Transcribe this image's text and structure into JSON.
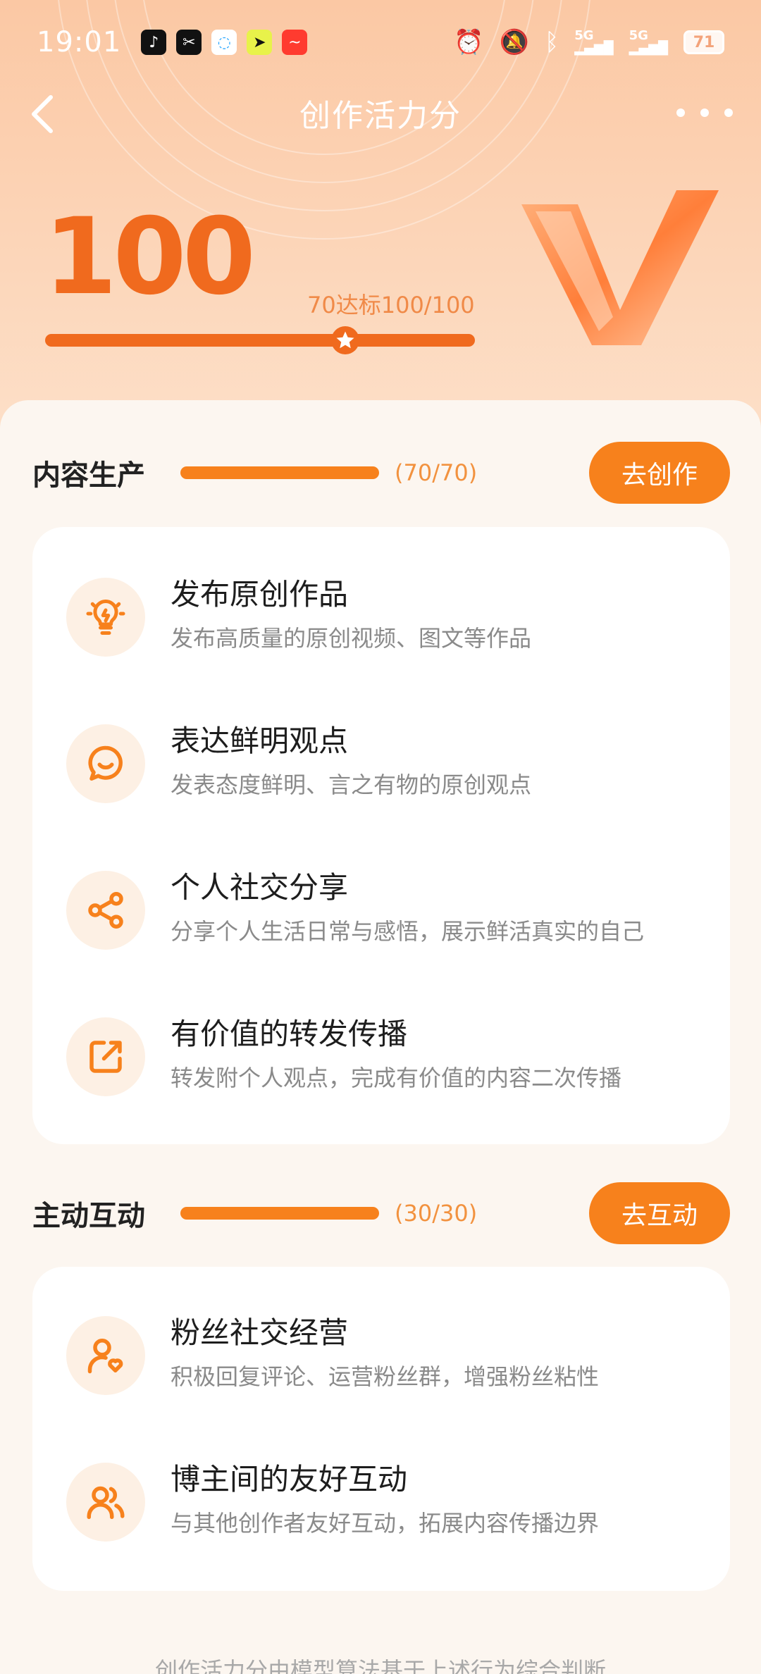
{
  "status_bar": {
    "time": "19:01",
    "battery": "71",
    "notification_icons": [
      "tiktok-icon",
      "capcut-icon",
      "chat-bubble-icon",
      "app-icon",
      "stock-app-icon"
    ],
    "system_icons": [
      "alarm-icon",
      "mute-icon",
      "bluetooth-icon",
      "signal-5g-icon",
      "signal-5g-icon"
    ],
    "signal_label": "5G"
  },
  "nav": {
    "title": "创作活力分",
    "back_icon": "chevron-left-icon",
    "more_icon": "more-dots-icon"
  },
  "summary": {
    "score": "100",
    "target_text": "70达标100/100",
    "progress": 1.0,
    "threshold": 0.7
  },
  "sections": [
    {
      "title": "内容生产",
      "count": "(70/70)",
      "progress": 1.0,
      "button": "去创作",
      "items": [
        {
          "icon": "lightbulb-icon",
          "title": "发布原创作品",
          "desc": "发布高质量的原创视频、图文等作品"
        },
        {
          "icon": "speech-bubble-icon",
          "title": "表达鲜明观点",
          "desc": "发表态度鲜明、言之有物的原创观点"
        },
        {
          "icon": "share-icon",
          "title": "个人社交分享",
          "desc": "分享个人生活日常与感悟，展示鲜活真实的自己"
        },
        {
          "icon": "forward-icon",
          "title": "有价值的转发传播",
          "desc": "转发附个人观点，完成有价值的内容二次传播"
        }
      ]
    },
    {
      "title": "主动互动",
      "count": "(30/30)",
      "progress": 1.0,
      "button": "去互动",
      "items": [
        {
          "icon": "user-heart-icon",
          "title": "粉丝社交经营",
          "desc": "积极回复评论、运营粉丝群，增强粉丝粘性"
        },
        {
          "icon": "users-icon",
          "title": "博主间的友好互动",
          "desc": "与其他创作者友好互动，拓展内容传播边界"
        }
      ]
    }
  ],
  "footer": "创作活力分由模型算法基于上述行为综合判断",
  "colors": {
    "accent": "#f7811c",
    "score": "#f06a1e",
    "icon_bg": "#fdf0e4"
  }
}
